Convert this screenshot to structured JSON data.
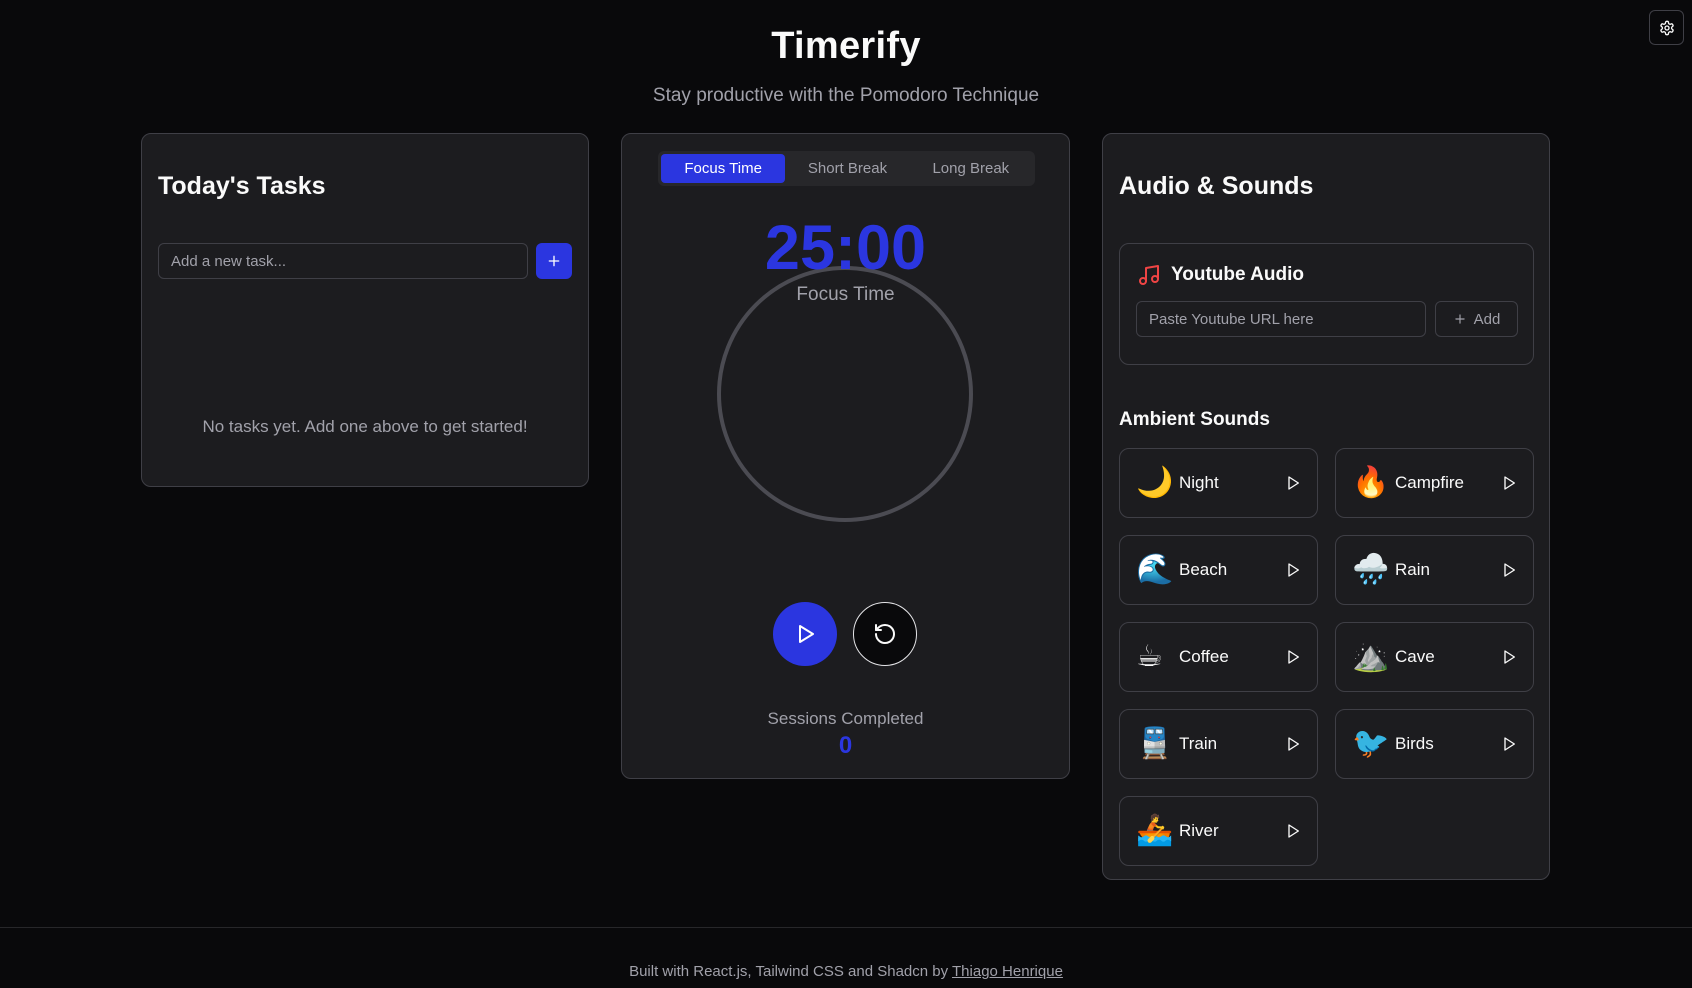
{
  "header": {
    "title": "Timerify",
    "subtitle": "Stay productive with the Pomodoro Technique"
  },
  "settings": {
    "icon": "gear-icon"
  },
  "tasks": {
    "title": "Today's Tasks",
    "input_placeholder": "Add a new task...",
    "add_icon": "plus-icon",
    "empty_message": "No tasks yet. Add one above to get started!"
  },
  "timer": {
    "tabs": [
      {
        "label": "Focus Time",
        "active": true
      },
      {
        "label": "Short Break",
        "active": false
      },
      {
        "label": "Long Break",
        "active": false
      }
    ],
    "display": "25:00",
    "mode_label": "Focus Time",
    "play_icon": "play-icon",
    "reset_icon": "reset-icon",
    "sessions_label": "Sessions Completed",
    "sessions_count": "0"
  },
  "audio": {
    "title": "Audio & Sounds",
    "youtube": {
      "title": "Youtube Audio",
      "icon": "music-note-icon",
      "input_placeholder": "Paste Youtube URL here",
      "add_label": "Add"
    },
    "ambient_title": "Ambient Sounds",
    "sounds": [
      {
        "name": "Night",
        "emoji": "🌙"
      },
      {
        "name": "Campfire",
        "emoji": "🔥"
      },
      {
        "name": "Beach",
        "emoji": "🌊"
      },
      {
        "name": "Rain",
        "emoji": "🌧️"
      },
      {
        "name": "Coffee",
        "emoji": "☕"
      },
      {
        "name": "Cave",
        "emoji": "⛰️"
      },
      {
        "name": "Train",
        "emoji": "🚆"
      },
      {
        "name": "Birds",
        "emoji": "🐦"
      },
      {
        "name": "River",
        "emoji": "🚣"
      }
    ]
  },
  "footer": {
    "text": "Built with React.js, Tailwind CSS and Shadcn by ",
    "link_label": "Thiago Henrique"
  },
  "colors": {
    "accent": "#2b36e0",
    "background": "#09090b",
    "card": "#1c1c1f",
    "border": "#3f3f46",
    "music_icon": "#ef4444"
  }
}
